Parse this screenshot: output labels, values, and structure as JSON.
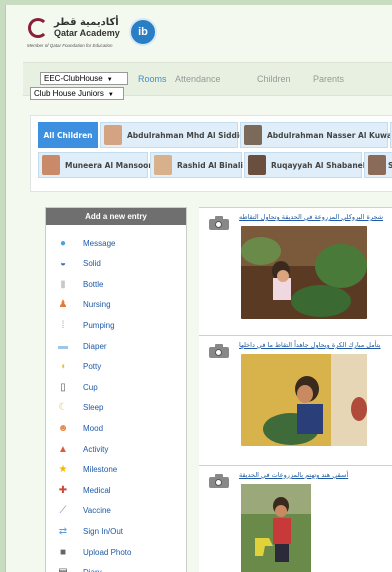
{
  "header": {
    "logo_arabic": "أكاديمية قطر",
    "logo_english": "Qatar Academy",
    "logo_tagline": "Member of Qatar Foundation for Education",
    "ib_logo": "ib"
  },
  "nav": {
    "clubhouse_select": "EEC-ClubHouse",
    "group_select": "Club House Juniors",
    "links": [
      "Rooms",
      "Attendance",
      "Children",
      "Parents"
    ]
  },
  "children_tabs": [
    "All Children",
    "Abdulrahman Mhd Al Siddiqi",
    "Abdulrahman Nasser Al Kuwari",
    "Muneera Al Mansoori",
    "Rashid Al Binali",
    "Ruqayyah Al Shabaneh",
    "Se"
  ],
  "entry_panel": {
    "title": "Add a new entry",
    "items": [
      {
        "label": "Message",
        "icon": "message-bubble-icon",
        "color": "#4aa3df"
      },
      {
        "label": "Solid",
        "icon": "bowl-icon",
        "color": "#3b6fb6"
      },
      {
        "label": "Bottle",
        "icon": "bottle-icon",
        "color": "#c9c9c9"
      },
      {
        "label": "Nursing",
        "icon": "nursing-icon",
        "color": "#e07b39"
      },
      {
        "label": "Pumping",
        "icon": "pump-icon",
        "color": "#9aa7b8"
      },
      {
        "label": "Diaper",
        "icon": "diaper-icon",
        "color": "#9fc6e6"
      },
      {
        "label": "Potty",
        "icon": "potty-icon",
        "color": "#f2c14e"
      },
      {
        "label": "Cup",
        "icon": "cup-icon",
        "color": "#555555"
      },
      {
        "label": "Sleep",
        "icon": "sleep-moon-icon",
        "color": "#d8c26a"
      },
      {
        "label": "Mood",
        "icon": "mood-face-icon",
        "color": "#e08a4a"
      },
      {
        "label": "Activity",
        "icon": "activity-blocks-icon",
        "color": "#e05a3a"
      },
      {
        "label": "Milestone",
        "icon": "star-icon",
        "color": "#f5b800"
      },
      {
        "label": "Medical",
        "icon": "medical-icon",
        "color": "#c94a3a"
      },
      {
        "label": "Vaccine",
        "icon": "syringe-icon",
        "color": "#8a6fc4"
      },
      {
        "label": "Sign In/Out",
        "icon": "sign-in-out-icon",
        "color": "#5aa0e0"
      },
      {
        "label": "Upload Photo",
        "icon": "camera-icon",
        "color": "#666666"
      },
      {
        "label": "Diary",
        "icon": "diary-icon",
        "color": "#444444"
      }
    ]
  },
  "feed": [
    {
      "caption": "شجرة البروكلي المزروعة في الحديقة وتحاول التقاطه"
    },
    {
      "caption": "يتأمل مبارك الكرة ويحاول جاهداً التقاط ما في داخلها"
    },
    {
      "caption": "أسقي هند وتهتم بالمزروعات في الحديقة"
    }
  ]
}
